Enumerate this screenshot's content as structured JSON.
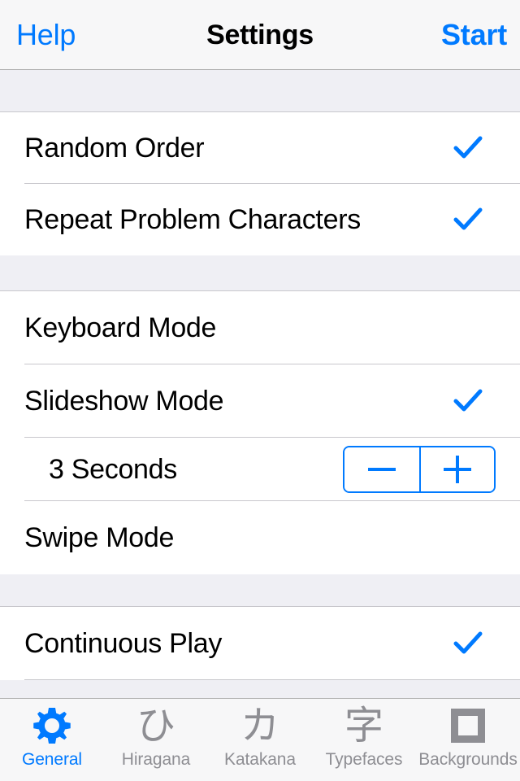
{
  "navbar": {
    "left_label": "Help",
    "title": "Settings",
    "right_label": "Start"
  },
  "accent_color": "#007AFF",
  "inactive_color": "#8E8E93",
  "separator_color": "#C8C7CC",
  "group_background": "#EFEFF4",
  "sections": [
    {
      "rows": [
        {
          "label": "Random Order",
          "checked": true,
          "checkmark": "✓"
        },
        {
          "label": "Repeat Problem Characters",
          "checked": true,
          "checkmark": "✓"
        }
      ]
    },
    {
      "rows": [
        {
          "label": "Keyboard Mode",
          "checked": false
        },
        {
          "label": "Slideshow Mode",
          "checked": true,
          "checkmark": "✓"
        },
        {
          "label": "3 Seconds",
          "indented": true,
          "stepper": {
            "decrement_label": "−",
            "increment_label": "+"
          }
        },
        {
          "label": "Swipe Mode",
          "checked": false
        }
      ]
    },
    {
      "rows": [
        {
          "label": "Continuous Play",
          "checked": true,
          "checkmark": "✓"
        }
      ]
    }
  ],
  "tabbar": {
    "items": [
      {
        "label": "General",
        "icon": "gear-icon",
        "glyph": "",
        "active": true
      },
      {
        "label": "Hiragana",
        "icon": "hiragana-hi-icon",
        "glyph": "ひ",
        "active": false
      },
      {
        "label": "Katakana",
        "icon": "katakana-ka-icon",
        "glyph": "カ",
        "active": false
      },
      {
        "label": "Typefaces",
        "icon": "kanji-ji-icon",
        "glyph": "字",
        "active": false
      },
      {
        "label": "Backgrounds",
        "icon": "square-icon",
        "glyph": "",
        "active": false
      }
    ]
  }
}
